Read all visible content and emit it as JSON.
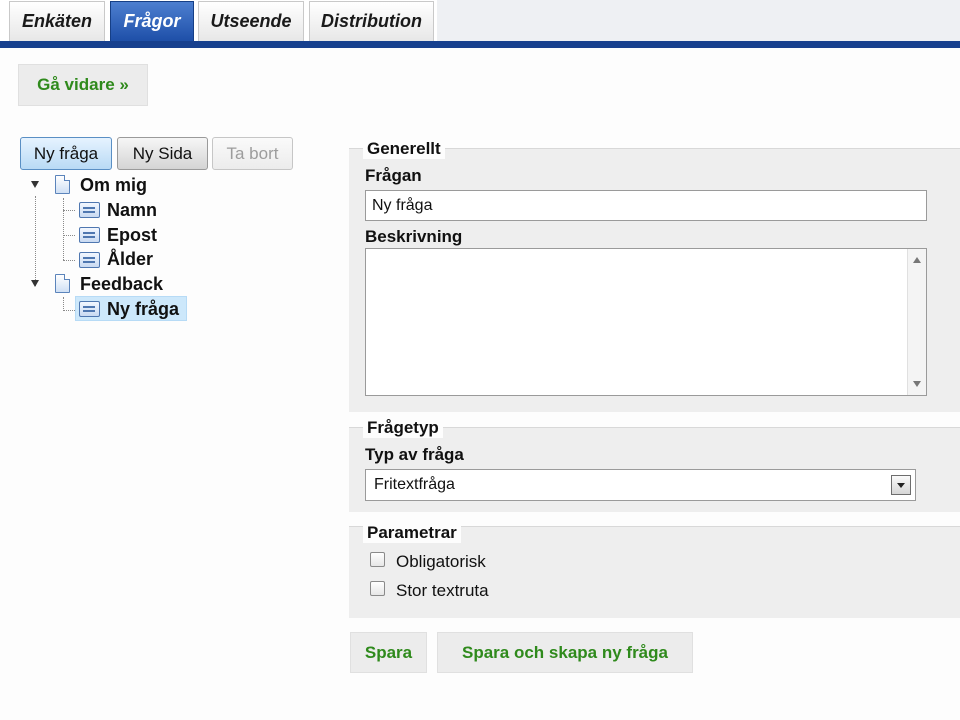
{
  "tabs": [
    {
      "label": "Enkäten",
      "active": false
    },
    {
      "label": "Frågor",
      "active": true
    },
    {
      "label": "Utseende",
      "active": false
    },
    {
      "label": "Distribution",
      "active": false
    }
  ],
  "toolbar": {
    "next_label": "Gå vidare »"
  },
  "tree_buttons": {
    "new_question": "Ny fråga",
    "new_page": "Ny Sida",
    "delete": "Ta bort"
  },
  "tree": {
    "pages": [
      {
        "label": "Om mig",
        "questions": [
          "Namn",
          "Epost",
          "Ålder"
        ]
      },
      {
        "label": "Feedback",
        "questions": [
          "Ny fråga"
        ]
      }
    ],
    "selected": "Ny fråga"
  },
  "general": {
    "legend": "Generellt",
    "question_label": "Frågan",
    "question_value": "Ny fråga",
    "description_label": "Beskrivning",
    "description_value": ""
  },
  "question_type": {
    "legend": "Frågetyp",
    "type_label": "Typ av fråga",
    "selected": "Fritextfråga"
  },
  "parameters": {
    "legend": "Parametrar",
    "options": [
      {
        "label": "Obligatorisk",
        "checked": false
      },
      {
        "label": "Stor textruta",
        "checked": false
      }
    ]
  },
  "actions": {
    "save": "Spara",
    "save_and_new": "Spara och skapa ny fråga"
  },
  "colors": {
    "tab_active": "#1e4fa8",
    "tab_bar": "#17408e",
    "action_text": "#2f8a1c",
    "selection": "#cde8fb"
  }
}
